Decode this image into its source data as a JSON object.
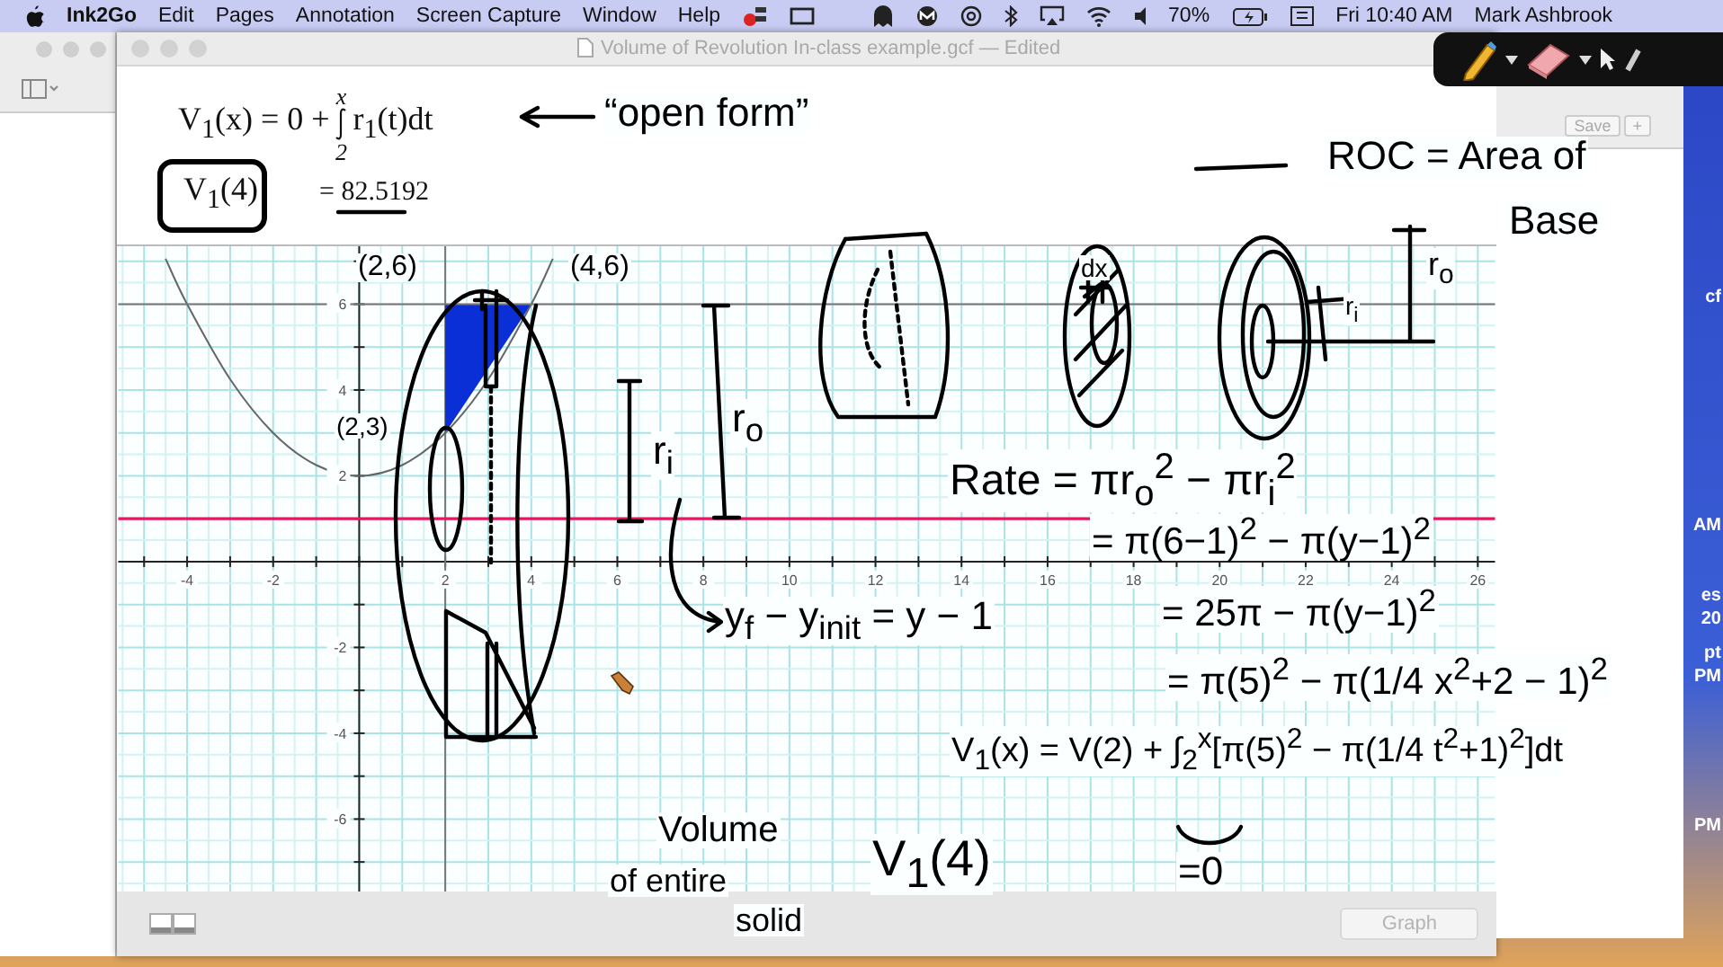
{
  "menu_bar": {
    "app_name": "Ink2Go",
    "items": [
      "Edit",
      "Pages",
      "Annotation",
      "Screen Capture",
      "Window",
      "Help"
    ],
    "battery": "70%",
    "clock": "Fri 10:40 AM",
    "user": "Mark Ashbrook"
  },
  "window": {
    "title": "Volume of Revolution In-class example.gcf — Edited"
  },
  "formula": {
    "lhs": "V$_{1}$(x) = 0 +",
    "upper_limit": "x",
    "lower_limit": "2",
    "integrand": "r$_{1}$(t)dt",
    "evaluated": "V$_{1}$(4)",
    "result": "= 82.5192"
  },
  "graph": {
    "chart_data": {
      "type": "line",
      "xlim": [
        -5.6,
        26.4
      ],
      "ylim": [
        -7.7,
        7.35
      ],
      "x": [
        -5.6,
        -4.5,
        -4,
        -3,
        -2,
        -1,
        0,
        1,
        2,
        3,
        4,
        4.5,
        26.4
      ],
      "series": [
        {
          "color": "#666666",
          "values": [
            null,
            7.06,
            6,
            4.25,
            3,
            2.25,
            2,
            2.25,
            3,
            4.25,
            6,
            7.06,
            null
          ]
        },
        {
          "color": "#e8175d",
          "values": [
            1,
            1,
            1,
            1,
            1,
            1,
            1,
            1,
            1,
            1,
            1,
            1,
            1
          ]
        },
        {
          "color": "#777777",
          "values": [
            6,
            6,
            6,
            6,
            6,
            6,
            6,
            6,
            6,
            6,
            6,
            6,
            6
          ]
        }
      ],
      "xticks": [
        -4,
        -2,
        2,
        4,
        6,
        8,
        10,
        12,
        14,
        16,
        18,
        20,
        22,
        24,
        26
      ],
      "yticks": [
        -6,
        -4,
        -2,
        2,
        4,
        6
      ],
      "grid": true,
      "ref_lines": [
        {
          "axis": "x",
          "value": 2
        }
      ]
    }
  },
  "annotations": [
    {
      "text": "“open form”"
    },
    {
      "text": "ROC = Area of"
    },
    {
      "text": "Base"
    },
    {
      "text": "(2,6)"
    },
    {
      "text": "(4,6)"
    },
    {
      "text": "dx"
    },
    {
      "text": "r$_{o}$"
    },
    {
      "text": "r$_{i}$"
    },
    {
      "text": "r$_{o}$"
    },
    {
      "text": "(2,3)"
    },
    {
      "text": "r$_{i}$"
    },
    {
      "text": "Rate = πr$_{o}$$^{2}$ − πr$_{i}$$^{2}$"
    },
    {
      "text": "= π(6−1)$^{2}$ − π(y−1)$^{2}$"
    },
    {
      "text": "y$_{f}$ − y$_{init}$ = y − 1"
    },
    {
      "text": "= 25π − π(y−1)$^{2}$"
    },
    {
      "text": "= π(5)$^{2}$ − π(1/4 x$^{2}$+2 − 1)$^{2}$"
    },
    {
      "text": "V$_{1}$(x) = V(2) + ∫$_{2}$$^{x}$[π(5)$^{2}$ − π(1/4 t$^{2}$+1)$^{2}$]dt"
    },
    {
      "text": "Volume"
    },
    {
      "text": "of entire"
    },
    {
      "text": "V$_{1}$(4)"
    },
    {
      "text": "=0"
    },
    {
      "text": "solid"
    }
  ],
  "bottom_bar": {
    "buttons": [
      {
        "label": "Graph",
        "disabled": true
      }
    ]
  },
  "side_window": {
    "buttons": [
      "Save",
      "+"
    ]
  },
  "desktop_labels": [
    "cf",
    "AM",
    "es",
    "20",
    "pt",
    "PM",
    "PM"
  ]
}
